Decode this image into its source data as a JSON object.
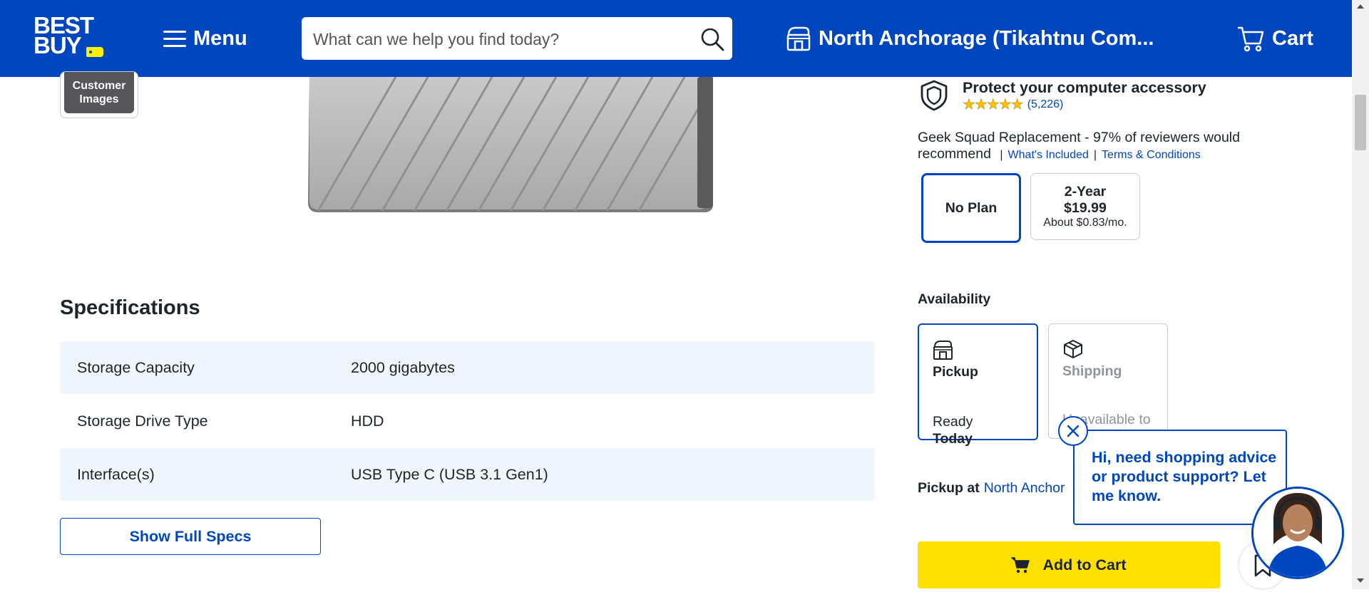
{
  "header": {
    "logo_text_line1": "BEST",
    "logo_text_line2": "BUY",
    "menu_label": "Menu",
    "search_placeholder": "What can we help you find today?",
    "store_label": "North Anchorage (Tikahtnu Com...",
    "cart_label": "Cart",
    "brand_color": "#0046be",
    "tag_color": "#fff200"
  },
  "gallery": {
    "thumb_label": "Customer Images"
  },
  "specifications": {
    "title": "Specifications",
    "rows": [
      {
        "key": "Storage Capacity",
        "value": "2000 gigabytes"
      },
      {
        "key": "Storage Drive Type",
        "value": "HDD"
      },
      {
        "key": "Interface(s)",
        "value": "USB Type C (USB 3.1 Gen1)"
      }
    ],
    "show_full_label": "Show Full Specs"
  },
  "protection": {
    "title": "Protect your computer accessory",
    "rating": 5,
    "review_count": "(5,226)",
    "description": "Geek Squad Replacement - 97% of reviewers would recommend",
    "whats_included": "What's Included",
    "terms": "Terms & Conditions",
    "plans": [
      {
        "title": "No Plan",
        "selected": true
      },
      {
        "title": "2-Year",
        "price": "$19.99",
        "monthly": "About $0.83/mo.",
        "selected": false
      }
    ]
  },
  "availability": {
    "title": "Availability",
    "pickup": {
      "title": "Pickup",
      "status_line1": "Ready",
      "status_line2": "Today"
    },
    "shipping": {
      "title": "Shipping",
      "status": "Unavailable to"
    },
    "pickup_at_label": "Pickup at",
    "pickup_store": "North Anchor"
  },
  "add_to_cart_label": "Add to Cart",
  "add_to_cart_color": "#ffe000",
  "chat": {
    "message": "Hi, need shopping advice or product support? Let me know."
  }
}
